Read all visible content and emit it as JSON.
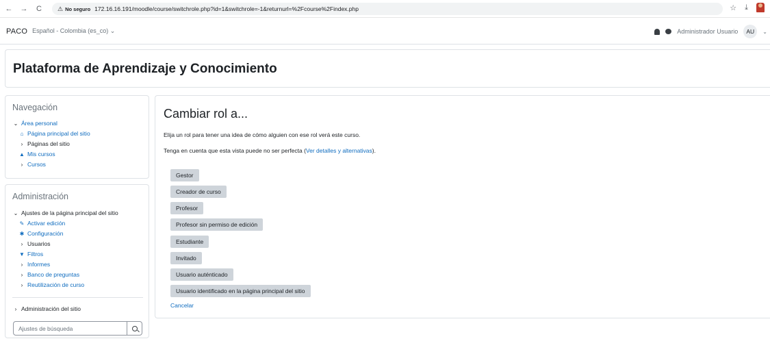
{
  "browser": {
    "back": "←",
    "forward": "→",
    "reload": "C",
    "security_label": "No seguro",
    "url": "172.16.16.191/moodle/course/switchrole.php?id=1&switchrole=-1&returnurl=%2Fcourse%2Findex.php",
    "star": "☆",
    "download": "⤓"
  },
  "navbar": {
    "brand": "PACO",
    "language": "Español - Colombia (es_co) ⌄",
    "user_name": "Administrador Usuario",
    "user_initials": "AU",
    "user_chevron": "⌄"
  },
  "header": {
    "title": "Plataforma de Aprendizaje y Conocimiento"
  },
  "navigation_block": {
    "title": "Navegación",
    "items": [
      {
        "label": "Área personal"
      },
      {
        "label": "Página principal del sitio"
      },
      {
        "label": "Páginas del sitio"
      },
      {
        "label": "Mis cursos"
      },
      {
        "label": "Cursos"
      }
    ]
  },
  "admin_block": {
    "title": "Administración",
    "section": "Ajustes de la página principal del sitio",
    "items": [
      {
        "label": "Activar edición"
      },
      {
        "label": "Configuración"
      },
      {
        "label": "Usuarios"
      },
      {
        "label": "Filtros"
      },
      {
        "label": "Informes"
      },
      {
        "label": "Banco de preguntas"
      },
      {
        "label": "Reutilización de curso"
      }
    ],
    "site_admin": "Administración del sitio",
    "search_placeholder": "Ajustes de búsqueda"
  },
  "main": {
    "title": "Cambiar rol a...",
    "intro": "Elija un rol para tener una idea de cómo alguien con ese rol verá este curso.",
    "note_prefix": "Tenga en cuenta que esta vista puede no ser perfecta (",
    "note_link": "Ver detalles y alternativas",
    "note_suffix": ").",
    "roles": [
      "Gestor",
      "Creador de curso",
      "Profesor",
      "Profesor sin permiso de edición",
      "Estudiante",
      "Invitado",
      "Usuario auténticado",
      "Usuario identificado en la página principal del sitio"
    ],
    "cancel": "Cancelar"
  }
}
